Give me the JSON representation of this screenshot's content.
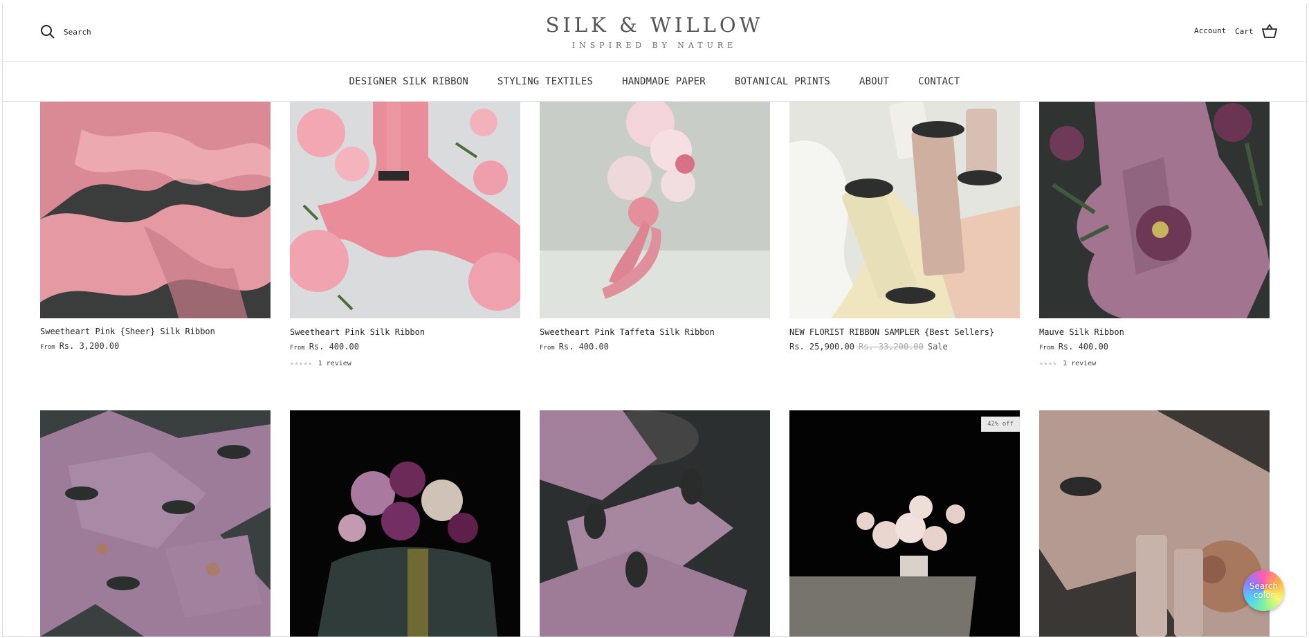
{
  "header": {
    "search_label": "Search",
    "logo_title": "SILK & WILLOW",
    "logo_tagline": "INSPIRED BY NATURE",
    "account_label": "Account",
    "cart_label": "Cart"
  },
  "nav": {
    "items": [
      "DESIGNER SILK RIBBON",
      "STYLING TEXTILES",
      "HANDMADE PAPER",
      "BOTANICAL PRINTS",
      "ABOUT",
      "CONTACT"
    ]
  },
  "products_row1": [
    {
      "title": "Sweetheart Pink {Sheer} Silk Ribbon",
      "from": "From",
      "price": "Rs. 3,200.00"
    },
    {
      "title": "Sweetheart Pink Silk Ribbon",
      "from": "From",
      "price": "Rs. 400.00",
      "stars": "★★★★★",
      "reviews": "1 review"
    },
    {
      "title": "Sweetheart Pink Taffeta Silk Ribbon",
      "from": "From",
      "price": "Rs. 400.00"
    },
    {
      "title": "NEW FLORIST RIBBON SAMPLER {Best Sellers}",
      "price": "Rs. 25,900.00",
      "compare_price": "Rs. 33,200.00",
      "sale": "Sale"
    },
    {
      "title": "Mauve Silk Ribbon",
      "from": "From",
      "price": "Rs. 400.00",
      "stars": "★★★★",
      "reviews": "1 review"
    }
  ],
  "products_row2": [
    {
      "badge": ""
    },
    {
      "badge": ""
    },
    {
      "badge": ""
    },
    {
      "badge": "42% off"
    },
    {
      "badge": ""
    }
  ],
  "widget": {
    "search_color": "Search color"
  },
  "colors": {
    "sweetheart_pink": "#e48a9a",
    "mauve": "#a0708e",
    "dark_bg": "#2b2f2f"
  }
}
